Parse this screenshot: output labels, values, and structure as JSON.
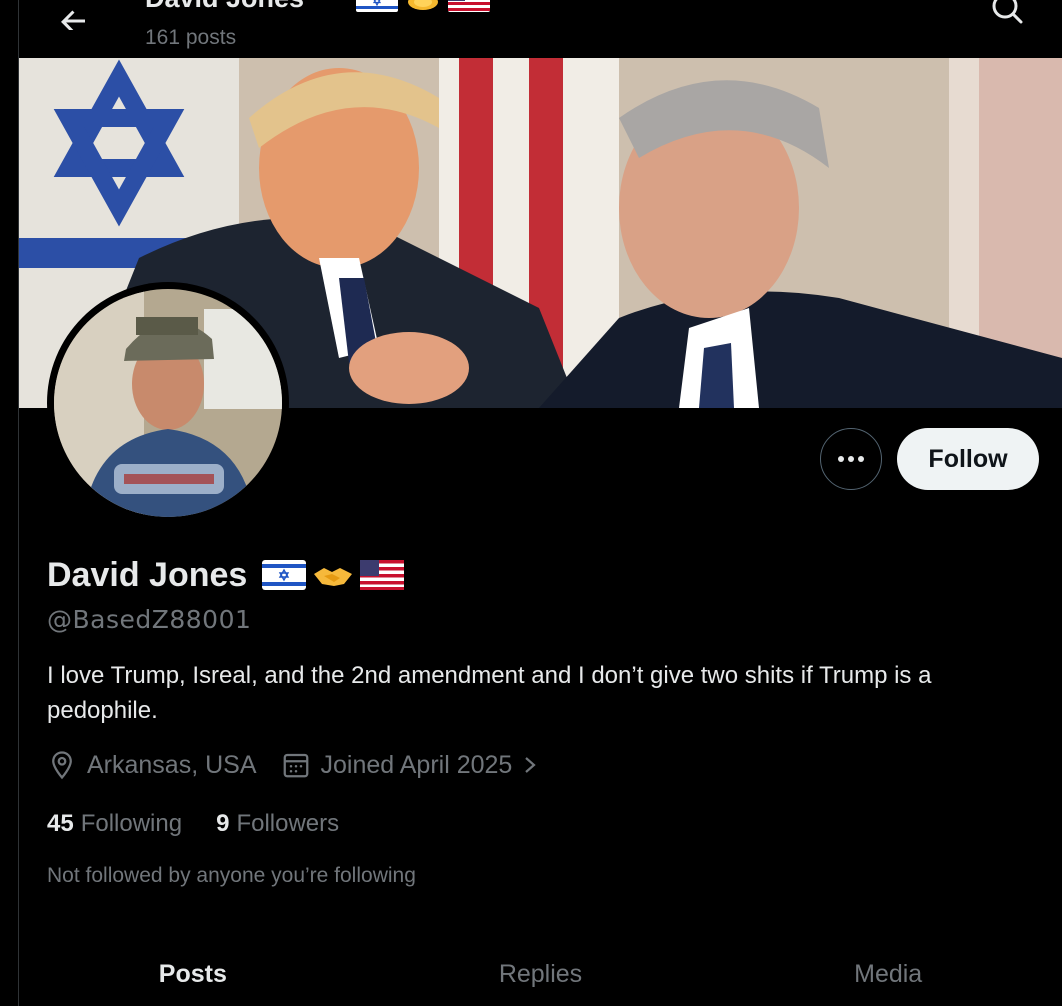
{
  "header": {
    "back_icon": "arrow-left-icon",
    "title": "David Jones",
    "posts_count": "161 posts",
    "search_icon": "search-icon"
  },
  "profile": {
    "name": "David Jones",
    "name_emojis": [
      "israel-flag",
      "handshake",
      "us-flag"
    ],
    "handle": "@BasedZ88001",
    "bio": "I love Trump, Isreal, and the 2nd amendment and I don’t give two shits if Trump is a pedophile.",
    "location": "Arkansas, USA",
    "joined": "Joined April 2025",
    "following_count": "45",
    "following_label": "Following",
    "followers_count": "9",
    "followers_label": "Followers",
    "not_followed_text": "Not followed by anyone you’re following"
  },
  "actions": {
    "more_icon": "more-horizontal-icon",
    "follow_label": "Follow"
  },
  "tabs": [
    {
      "label": "Posts",
      "active": true
    },
    {
      "label": "Replies",
      "active": false
    },
    {
      "label": "Media",
      "active": false
    }
  ],
  "colors": {
    "background": "#000000",
    "text_primary": "#e7e9ea",
    "text_secondary": "#71767b",
    "follow_bg": "#eff3f4",
    "border": "#2f3336"
  }
}
